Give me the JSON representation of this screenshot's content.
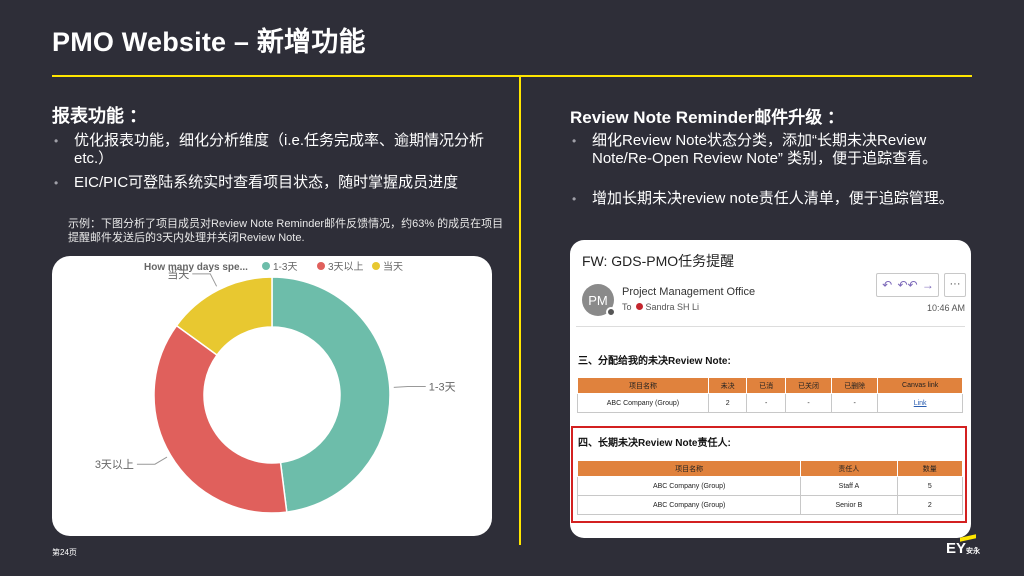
{
  "slide": {
    "title": "PMO Website – 新增功能",
    "page_number": "第24页",
    "logo": "EY",
    "logo_sub": "安永"
  },
  "left": {
    "title": "报表功能 ：",
    "bullets": [
      "优化报表功能，细化分析维度（i.e.任务完成率、逾期情况分析etc.）",
      "EIC/PIC可登陆系统实时查看项目状态，随时掌握成员进度"
    ],
    "example": "示例：下图分析了项目成员对Review Note Reminder邮件反馈情况，约63% 的成员在项目提醒邮件发送后的3天内处理并关闭Review Note."
  },
  "chart_data": {
    "type": "pie",
    "title": "How many days spe...",
    "categories": [
      "1-3天",
      "3天以上",
      "当天"
    ],
    "values": [
      48,
      37,
      15
    ],
    "colors": [
      "#6dbdaa",
      "#e0605c",
      "#e8c830"
    ],
    "legend": "top",
    "donut": true
  },
  "right": {
    "title": "Review Note Reminder邮件升级 ：",
    "bullets": [
      "细化Review Note状态分类，添加“长期未决Review Note/Re-Open Review Note” 类别，便于追踪查看。",
      "增加长期未决review note责任人清单，便于追踪管理。"
    ]
  },
  "email": {
    "subject": "FW: GDS-PMO任务提醒",
    "avatar_initials": "PM",
    "sender": "Project Management Office",
    "to_label": "To",
    "recipient": "Sandra SH Li",
    "time": "10:46 AM",
    "actions": [
      "↶",
      "↶↶",
      "→"
    ],
    "more": "···",
    "section3_title": "三、分配给我的未决Review Note:",
    "table3": {
      "headers": [
        "项目名称",
        "未决",
        "已消",
        "已关闭",
        "已删除",
        "Canvas link"
      ],
      "rows": [
        [
          "ABC Company (Group)",
          "2",
          "-",
          "-",
          "-",
          "Link"
        ]
      ]
    },
    "section4_title": "四、长期未决Review Note责任人:",
    "table4": {
      "headers": [
        "项目名称",
        "责任人",
        "数量"
      ],
      "rows": [
        [
          "ABC Company (Group)",
          "Staff A",
          "5"
        ],
        [
          "ABC Company (Group)",
          "Senior B",
          "2"
        ]
      ]
    }
  },
  "colors": {
    "background": "#2e2e38",
    "accent": "#ffe600",
    "table_header": "#e0823d",
    "highlight_box": "#d32020"
  }
}
